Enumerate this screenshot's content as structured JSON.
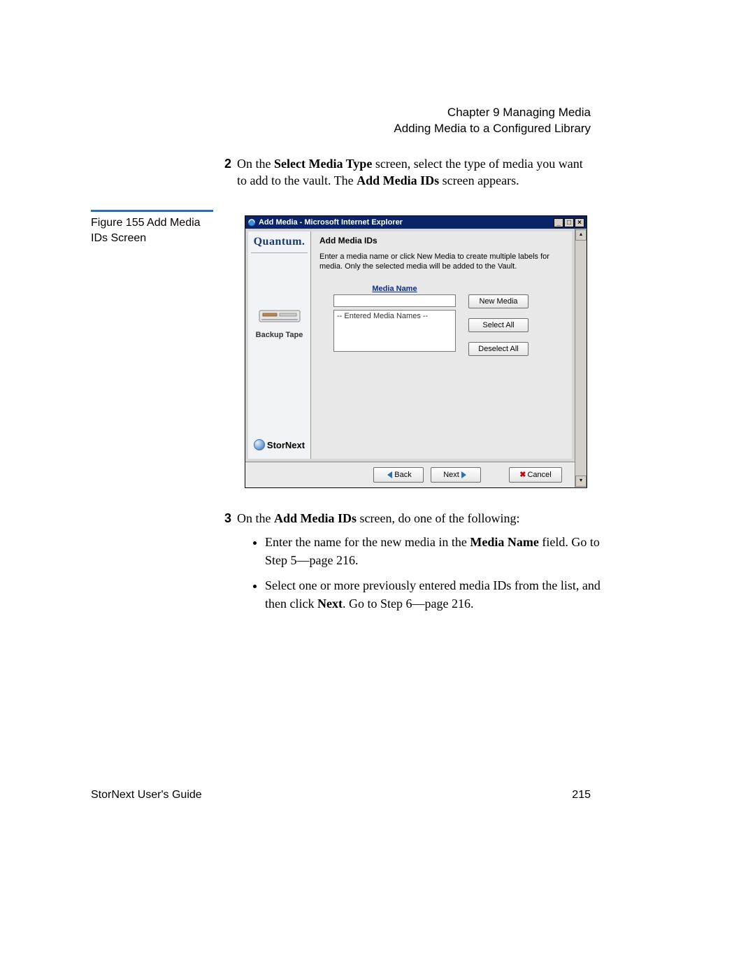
{
  "header": {
    "chapter": "Chapter 9  Managing Media",
    "section": "Adding Media to a Configured Library"
  },
  "step2": {
    "num": "2",
    "text_pre": "On the ",
    "bold1": "Select Media Type",
    "text_mid": " screen, select the type of media you want to add to the vault. The ",
    "bold2": "Add Media IDs",
    "text_post": " screen appears."
  },
  "caption": "Figure 155  Add Media IDs Screen",
  "screenshot": {
    "title": "Add Media - Microsoft Internet Explorer",
    "left": {
      "brand": "Quantum.",
      "tape_label": "Backup Tape",
      "product": "StorNext"
    },
    "right": {
      "heading": "Add Media IDs",
      "desc": "Enter a media name or click New Media to create multiple labels for media. Only the selected media will be added to the Vault.",
      "media_name_label": "Media Name",
      "listbox_placeholder": "-- Entered Media Names --",
      "buttons": {
        "new_media": "New Media",
        "select_all": "Select All",
        "deselect_all": "Deselect All"
      }
    },
    "wizard": {
      "back": "Back",
      "next": "Next",
      "cancel": "Cancel"
    },
    "winbtns": {
      "min": "_",
      "max": "□",
      "close": "×"
    }
  },
  "step3": {
    "num": "3",
    "lead_pre": "On the ",
    "lead_bold": "Add Media IDs",
    "lead_post": " screen, do one of the following:",
    "bullet1_pre": "Enter the name for the new media in the ",
    "bullet1_bold": "Media Name",
    "bullet1_post": " field. Go to Step 5—page 216.",
    "bullet2_pre": "Select one or more previously entered media IDs from the list, and then click ",
    "bullet2_bold": "Next",
    "bullet2_post": ". Go to Step 6—page 216."
  },
  "footer": {
    "left": "StorNext User's Guide",
    "right": "215"
  }
}
